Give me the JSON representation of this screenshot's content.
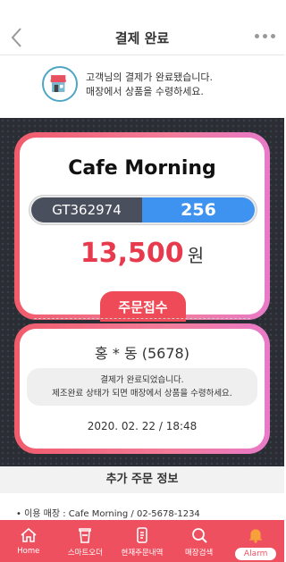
{
  "header": {
    "title": "결제 완료"
  },
  "notice": {
    "line1": "고객님의 결제가 완료됐습니다.",
    "line2": "매장에서 상품을 수령하세요."
  },
  "order_card": {
    "shop_name": "Cafe Morning",
    "order_code": "GT362974",
    "order_number": "256",
    "amount": "13,500",
    "currency_unit": "원",
    "status_tab": "주문접수"
  },
  "customer_card": {
    "customer": "홍 * 동 (5678)",
    "message_line1": "결제가 완료되었습니다.",
    "message_line2": "제조완료 상태가 되면 매장에서 상품을 수령하세요.",
    "date": "2020. 02. 22 / 18:48"
  },
  "extra": {
    "heading": "추가 주문 정보",
    "store_line": "• 이용 매장 : Cafe Morning / 02-5678-1234"
  },
  "nav": {
    "items": [
      {
        "label": "Home",
        "icon": "home-icon"
      },
      {
        "label": "스마트오더",
        "icon": "cup-icon"
      },
      {
        "label": "현재주문내역",
        "icon": "order-list-icon"
      },
      {
        "label": "매장검색",
        "icon": "search-icon"
      },
      {
        "label": "Alarm",
        "icon": "bell-icon"
      }
    ]
  },
  "colors": {
    "accent": "#ef5060",
    "code_blue": "#3f93f0",
    "code_dark": "#4a4f5e",
    "amount_red": "#e73a4c"
  }
}
